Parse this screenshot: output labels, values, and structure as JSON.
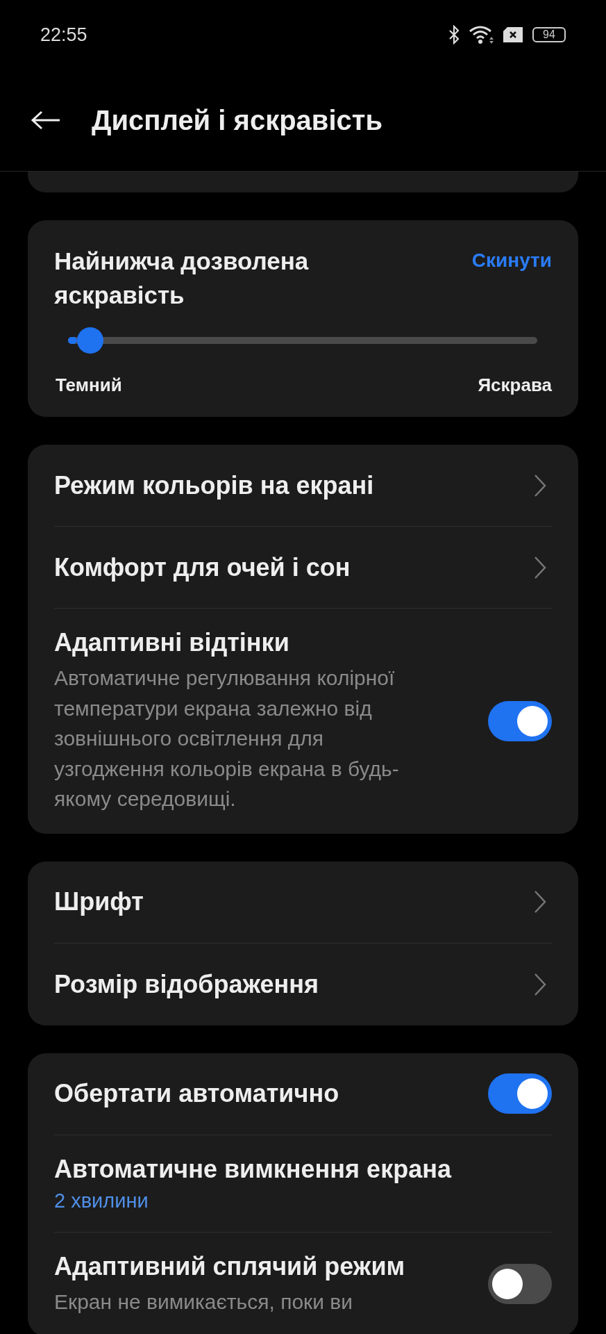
{
  "status_bar": {
    "time": "22:55",
    "battery": "94"
  },
  "header": {
    "title": "Дисплей і яскравість"
  },
  "brightness": {
    "title": "Найнижча дозволена яскравість",
    "reset": "Скинути",
    "level": 0.047,
    "min_label": "Темний",
    "max_label": "Яскрава"
  },
  "groups": [
    {
      "items": [
        {
          "kind": "link",
          "title": "Режим кольорів на екрані"
        },
        {
          "kind": "link",
          "title": "Комфорт для очей і сон"
        },
        {
          "kind": "toggle",
          "title": "Адаптивні відтінки",
          "description": "Автоматичне регулювання колірної температури екрана залежно від зовнішнього освітлення для узгодження кольорів екрана в будь-якому середовищі.",
          "on": true
        }
      ]
    },
    {
      "items": [
        {
          "kind": "link",
          "title": "Шрифт"
        },
        {
          "kind": "link",
          "title": "Розмір відображення"
        }
      ]
    },
    {
      "items": [
        {
          "kind": "toggle",
          "title": "Обертати автоматично",
          "on": true
        },
        {
          "kind": "value",
          "title": "Автоматичне вимкнення екрана",
          "value": "2 хвилини"
        },
        {
          "kind": "toggle",
          "title": "Адаптивний сплячий режим",
          "description": "Екран не вимикається, поки ви",
          "on": false
        }
      ]
    }
  ]
}
